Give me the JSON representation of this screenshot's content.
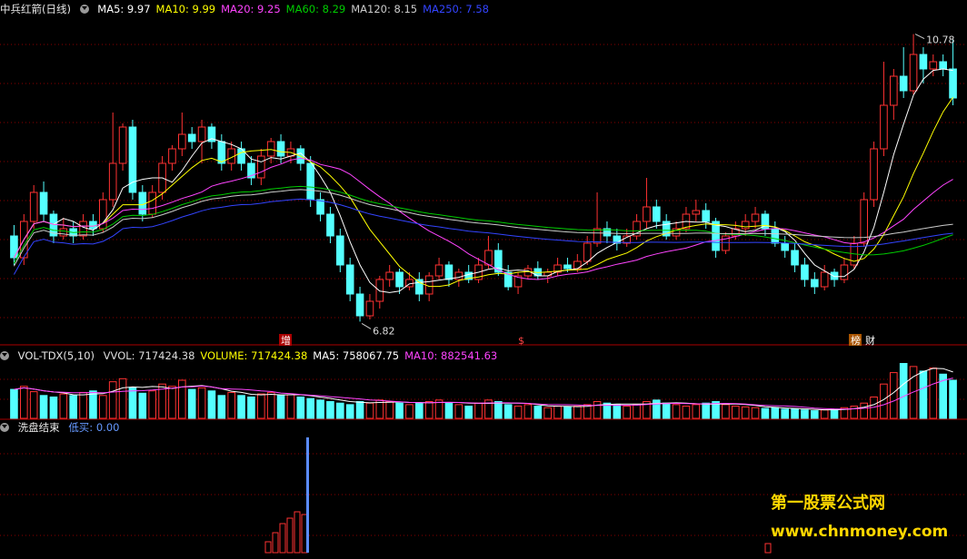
{
  "header": {
    "main": {
      "title": "中兵红箭(日线)",
      "items": [
        {
          "label": "MA5: 9.97",
          "color": "#ffffff"
        },
        {
          "label": "MA10: 9.99",
          "color": "#ffff00"
        },
        {
          "label": "MA20: 9.25",
          "color": "#ff44ff"
        },
        {
          "label": "MA60: 8.29",
          "color": "#00cc00"
        },
        {
          "label": "MA120: 8.15",
          "color": "#cccccc"
        },
        {
          "label": "MA250: 7.58",
          "color": "#3344ff"
        }
      ]
    },
    "vol": {
      "title": "VOL-TDX(5,10)",
      "items": [
        {
          "label": "VVOL: 717424.38",
          "color": "#dddddd"
        },
        {
          "label": "VOLUME: 717424.38",
          "color": "#ffff00"
        },
        {
          "label": "MA5: 758067.75",
          "color": "#ffffff"
        },
        {
          "label": "MA10: 882541.63",
          "color": "#ff44ff"
        }
      ]
    },
    "ind": {
      "title": "洗盘结束",
      "items": [
        {
          "label": "低买: 0.00",
          "color": "#6699ff"
        }
      ]
    }
  },
  "annotations": {
    "high_label": "10.78",
    "low_label": "6.82",
    "tag_zeng": "增",
    "tag_dollar": "$",
    "tag_bang": "榜",
    "tag_cai": "财"
  },
  "watermark": {
    "line1": "第一股票公式网",
    "line2": "www.chnmoney.com"
  },
  "colors": {
    "up": "#ff3232",
    "down": "#54ffff",
    "ma5": "#ffffff",
    "ma10": "#ffff00",
    "ma20": "#ff44ff",
    "ma60": "#00cc00",
    "ma120": "#cccccc",
    "ma250": "#3344ff",
    "grid": "#8b0000"
  },
  "chart_data": [
    {
      "type": "candlestick",
      "name": "price",
      "high": 10.78,
      "low": 6.82,
      "ylim": [
        6.6,
        11.0
      ],
      "candles": [
        [
          8.0,
          7.7,
          8.15,
          7.6
        ],
        [
          7.7,
          8.2,
          8.3,
          7.6
        ],
        [
          8.2,
          8.6,
          8.7,
          8.1
        ],
        [
          8.6,
          8.3,
          8.75,
          8.2
        ],
        [
          8.3,
          8.0,
          8.35,
          7.9
        ],
        [
          8.0,
          8.1,
          8.25,
          7.95
        ],
        [
          8.1,
          8.0,
          8.2,
          7.9
        ],
        [
          8.0,
          8.2,
          8.3,
          7.95
        ],
        [
          8.2,
          8.1,
          8.3,
          8.0
        ],
        [
          8.1,
          8.5,
          8.6,
          8.05
        ],
        [
          8.5,
          9.0,
          9.7,
          8.4
        ],
        [
          9.0,
          9.5,
          9.55,
          8.9
        ],
        [
          9.5,
          8.6,
          9.6,
          8.5
        ],
        [
          8.6,
          8.3,
          8.7,
          8.2
        ],
        [
          8.3,
          8.6,
          8.7,
          8.25
        ],
        [
          8.6,
          9.0,
          9.1,
          8.5
        ],
        [
          9.0,
          9.2,
          9.25,
          8.9
        ],
        [
          9.2,
          9.4,
          9.7,
          9.1
        ],
        [
          9.4,
          9.3,
          9.5,
          9.2
        ],
        [
          9.3,
          9.5,
          9.6,
          9.0
        ],
        [
          9.5,
          9.3,
          9.55,
          9.2
        ],
        [
          9.3,
          9.0,
          9.4,
          8.9
        ],
        [
          9.0,
          9.2,
          9.3,
          8.9
        ],
        [
          9.2,
          9.0,
          9.3,
          8.9
        ],
        [
          9.0,
          8.8,
          9.1,
          8.7
        ],
        [
          8.8,
          9.1,
          9.2,
          8.7
        ],
        [
          9.1,
          9.3,
          9.35,
          9.0
        ],
        [
          9.3,
          9.1,
          9.4,
          9.0
        ],
        [
          9.1,
          9.2,
          9.3,
          9.0
        ],
        [
          9.2,
          9.0,
          9.25,
          8.9
        ],
        [
          9.0,
          8.5,
          9.1,
          8.4
        ],
        [
          8.5,
          8.3,
          8.6,
          8.2
        ],
        [
          8.3,
          8.0,
          8.4,
          7.9
        ],
        [
          8.0,
          7.6,
          8.1,
          7.5
        ],
        [
          7.6,
          7.2,
          7.7,
          7.1
        ],
        [
          7.2,
          6.9,
          7.3,
          6.82
        ],
        [
          6.9,
          7.1,
          7.2,
          6.85
        ],
        [
          7.1,
          7.4,
          7.45,
          7.0
        ],
        [
          7.4,
          7.5,
          7.6,
          7.3
        ],
        [
          7.5,
          7.3,
          7.55,
          7.2
        ],
        [
          7.3,
          7.4,
          7.5,
          7.25
        ],
        [
          7.4,
          7.2,
          7.5,
          7.1
        ],
        [
          7.2,
          7.45,
          7.5,
          7.1
        ],
        [
          7.45,
          7.6,
          7.7,
          7.4
        ],
        [
          7.6,
          7.4,
          7.65,
          7.3
        ],
        [
          7.4,
          7.5,
          7.55,
          7.3
        ],
        [
          7.5,
          7.4,
          7.6,
          7.35
        ],
        [
          7.4,
          7.6,
          7.7,
          7.35
        ],
        [
          7.6,
          7.8,
          8.0,
          7.55
        ],
        [
          7.8,
          7.5,
          7.9,
          7.45
        ],
        [
          7.5,
          7.3,
          7.6,
          7.25
        ],
        [
          7.3,
          7.45,
          7.5,
          7.2
        ],
        [
          7.45,
          7.55,
          7.6,
          7.4
        ],
        [
          7.55,
          7.45,
          7.65,
          7.4
        ],
        [
          7.45,
          7.5,
          7.55,
          7.35
        ],
        [
          7.5,
          7.6,
          7.7,
          7.45
        ],
        [
          7.6,
          7.55,
          7.7,
          7.5
        ],
        [
          7.55,
          7.65,
          7.75,
          7.5
        ],
        [
          7.65,
          7.9,
          8.0,
          7.6
        ],
        [
          7.9,
          8.1,
          8.6,
          7.85
        ],
        [
          8.1,
          8.0,
          8.2,
          7.9
        ],
        [
          8.0,
          7.9,
          8.1,
          7.8
        ],
        [
          7.9,
          8.0,
          8.1,
          7.85
        ],
        [
          8.0,
          8.2,
          8.3,
          7.95
        ],
        [
          8.2,
          8.4,
          8.8,
          8.1
        ],
        [
          8.4,
          8.2,
          8.5,
          8.1
        ],
        [
          8.2,
          8.0,
          8.3,
          7.95
        ],
        [
          8.0,
          8.1,
          8.2,
          7.95
        ],
        [
          8.1,
          8.3,
          8.4,
          8.05
        ],
        [
          8.3,
          8.35,
          8.5,
          8.2
        ],
        [
          8.35,
          8.2,
          8.45,
          8.1
        ],
        [
          8.2,
          7.8,
          8.25,
          7.7
        ],
        [
          7.8,
          8.0,
          8.05,
          7.75
        ],
        [
          8.0,
          8.1,
          8.2,
          7.95
        ],
        [
          8.1,
          8.2,
          8.3,
          8.0
        ],
        [
          8.2,
          8.3,
          8.4,
          8.1
        ],
        [
          8.3,
          8.1,
          8.35,
          8.0
        ],
        [
          8.1,
          7.9,
          8.2,
          7.85
        ],
        [
          7.9,
          7.8,
          8.0,
          7.7
        ],
        [
          7.8,
          7.6,
          7.9,
          7.5
        ],
        [
          7.6,
          7.4,
          7.7,
          7.3
        ],
        [
          7.4,
          7.3,
          7.5,
          7.2
        ],
        [
          7.3,
          7.5,
          7.6,
          7.25
        ],
        [
          7.5,
          7.4,
          7.55,
          7.3
        ],
        [
          7.4,
          7.6,
          7.7,
          7.35
        ],
        [
          7.6,
          7.9,
          8.0,
          7.55
        ],
        [
          7.9,
          8.5,
          8.6,
          7.85
        ],
        [
          8.5,
          9.2,
          9.3,
          8.4
        ],
        [
          9.2,
          9.8,
          10.4,
          9.1
        ],
        [
          9.8,
          10.2,
          10.3,
          9.6
        ],
        [
          10.2,
          10.0,
          10.6,
          9.9
        ],
        [
          10.0,
          10.5,
          10.78,
          9.95
        ],
        [
          10.5,
          10.3,
          10.6,
          10.1
        ],
        [
          10.3,
          10.4,
          10.5,
          10.2
        ],
        [
          10.4,
          10.3,
          10.5,
          10.2
        ],
        [
          10.3,
          9.9,
          10.7,
          9.8
        ]
      ]
    },
    {
      "type": "bar",
      "name": "volume",
      "values": [
        38,
        42,
        35,
        30,
        28,
        32,
        30,
        34,
        36,
        30,
        48,
        52,
        40,
        33,
        36,
        45,
        42,
        50,
        38,
        40,
        36,
        30,
        34,
        30,
        28,
        32,
        34,
        30,
        31,
        28,
        26,
        24,
        22,
        20,
        18,
        22,
        20,
        24,
        22,
        20,
        18,
        20,
        22,
        24,
        20,
        18,
        16,
        20,
        24,
        22,
        18,
        16,
        18,
        16,
        14,
        16,
        15,
        16,
        18,
        22,
        20,
        18,
        16,
        18,
        22,
        24,
        20,
        18,
        16,
        18,
        20,
        22,
        18,
        16,
        15,
        14,
        13,
        14,
        12,
        12,
        11,
        10,
        11,
        12,
        14,
        16,
        20,
        28,
        45,
        60,
        72,
        68,
        62,
        66,
        58,
        50
      ],
      "ylim": [
        0,
        75
      ]
    },
    {
      "type": "bar",
      "name": "洗盘结束",
      "values": [
        0,
        0,
        0,
        0,
        0,
        0,
        0,
        0,
        0,
        0,
        0,
        0,
        0,
        0,
        0,
        0,
        0,
        0,
        0,
        0,
        0,
        0,
        0,
        0,
        0,
        0,
        0,
        0,
        0,
        0,
        0,
        0,
        0,
        0,
        0,
        0,
        0,
        0,
        0,
        0,
        0,
        0,
        0,
        0,
        0,
        0,
        0,
        0,
        0,
        0,
        0,
        0,
        0,
        0,
        0,
        0,
        0,
        0,
        0,
        0,
        0,
        0,
        0,
        0,
        0,
        0,
        0,
        0,
        0,
        0,
        0,
        0,
        0,
        0,
        0,
        0,
        0,
        0,
        0,
        0,
        0,
        0,
        0,
        0,
        0,
        0,
        0,
        0,
        0,
        0,
        0,
        0,
        0,
        0,
        0,
        0
      ],
      "ylim": [
        0,
        100
      ]
    }
  ]
}
